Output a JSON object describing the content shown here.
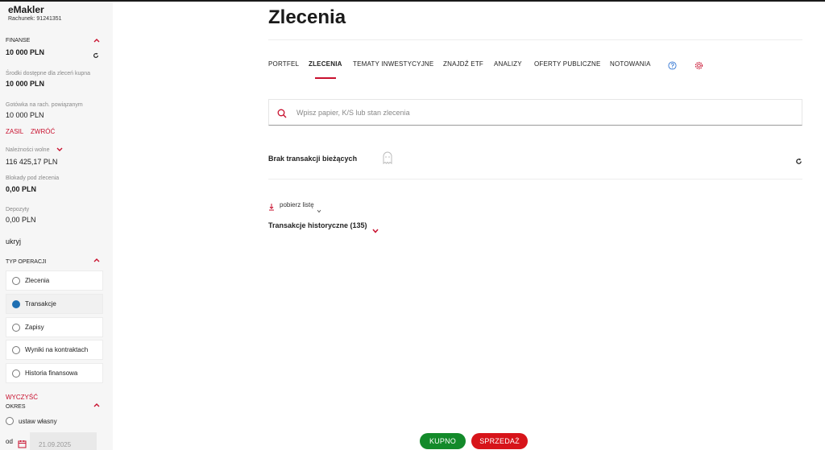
{
  "sidebar": {
    "brand": "eMakler",
    "account": "Rachunek: 91241351",
    "finance": {
      "heading": "FINANSE",
      "balance": "10 000 PLN",
      "available_label": "Środki dostępne dla zleceń kupna",
      "available_value": "10 000 PLN",
      "linked_cash_label": "Gotówka na rach. powiązanym",
      "linked_cash_value": "10 000 PLN",
      "topup_link": "ZASIL",
      "withdraw_link": "ZWRÓĆ",
      "receivables_label": "Należności wolne",
      "receivables_value": "116 425,17 PLN",
      "blocked_label": "Blokady pod zlecenia",
      "blocked_value": "0,00 PLN",
      "deposits_label": "Depozyty",
      "deposits_value": "0,00 PLN",
      "hide_link": "ukryj"
    },
    "operation_type": {
      "heading": "TYP OPERACJI",
      "options": [
        {
          "label": "Zlecenia",
          "selected": false
        },
        {
          "label": "Transakcje",
          "selected": true
        },
        {
          "label": "Zapisy",
          "selected": false
        },
        {
          "label": "Wyniki na kontraktach",
          "selected": false
        },
        {
          "label": "Historia finansowa",
          "selected": false
        }
      ],
      "clear_link": "WYCZYŚĆ"
    },
    "period": {
      "heading": "OKRES",
      "custom_label": "ustaw własny",
      "from_label": "od",
      "from_date": "21.09.2025"
    }
  },
  "main": {
    "title": "Zlecenia",
    "tabs": [
      {
        "label": "PORTFEL",
        "active": false
      },
      {
        "label": "ZLECENIA",
        "active": true
      },
      {
        "label": "TEMATY INWESTYCYJNE",
        "active": false
      },
      {
        "label": "ZNAJDŹ ETF",
        "active": false
      },
      {
        "label": "ANALIZY",
        "active": false
      },
      {
        "label": "OFERTY PUBLICZNE",
        "active": false
      },
      {
        "label": "NOTOWANIA",
        "active": false
      }
    ],
    "search_placeholder": "Wpisz papier, K/S lub stan zlecenia",
    "empty_state": "Brak transakcji bieżących",
    "download_label": "pobierz listę",
    "history_label": "Transakcje historyczne (135)"
  },
  "actions": {
    "buy_label": "KUPNO",
    "sell_label": "SPRZEDAŻ"
  },
  "colors": {
    "accent": "#c8102e",
    "buy": "#138a2a",
    "sell": "#d7141a",
    "selected_radio": "#1f6fb2"
  },
  "icons": [
    "refresh-icon",
    "chevron-up-icon",
    "chevron-down-icon",
    "help-icon",
    "settings-icon",
    "search-icon",
    "ghost-icon",
    "download-icon",
    "calendar-icon"
  ]
}
